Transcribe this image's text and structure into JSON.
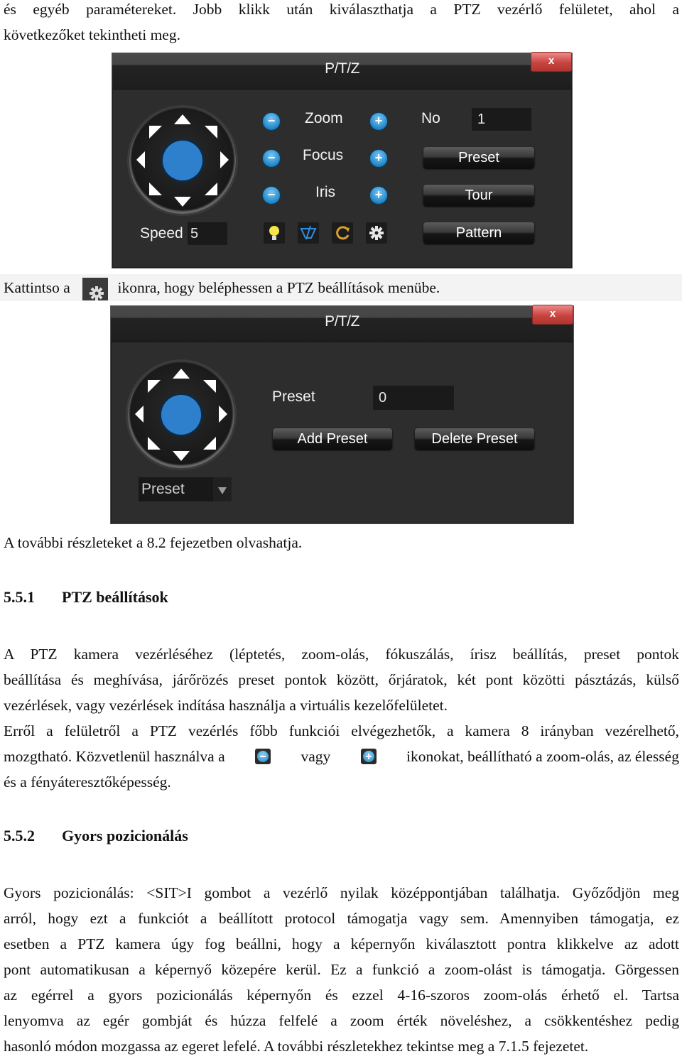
{
  "intro": {
    "lines": [
      "és egyéb paramétereket. Jobb klikk után kiválaszthatja a PTZ vezérlő felületet, ahol a",
      "következőket tekintheti meg."
    ]
  },
  "ptz_panel": {
    "title": "P/T/Z",
    "close_label": "x",
    "speed_label": "Speed",
    "speed_value": "5",
    "rows": [
      {
        "label": "Zoom",
        "minus": "−",
        "plus": "+"
      },
      {
        "label": "Focus",
        "minus": "−",
        "plus": "+"
      },
      {
        "label": "Iris",
        "minus": "−",
        "plus": "+"
      }
    ],
    "no_label": "No",
    "no_value": "1",
    "buttons": [
      "Preset",
      "Tour",
      "Pattern"
    ],
    "tools": [
      "light-bulb-icon",
      "wiper-icon",
      "auto-rotate-icon",
      "settings-gear-icon"
    ]
  },
  "instruction": {
    "before_icon": "Kattintso a",
    "after_icon": "ikonra, hogy beléphessen a PTZ beállítások menübe."
  },
  "ptz_settings_panel": {
    "title": "P/T/Z",
    "close_label": "x",
    "preset_label": "Preset",
    "preset_value": "0",
    "add_preset": "Add Preset",
    "delete_preset": "Delete Preset",
    "mode_select": "Preset"
  },
  "more_details": "A további részleteket a 8.2 fejezetben olvashatja.",
  "section_551": {
    "number": "5.5.1",
    "title": "PTZ beállítások",
    "para1_lines": [
      "A PTZ kamera vezérléséhez (léptetés, zoom-olás, fókuszálás, írisz beállítás, preset pontok",
      "beállítása és meghívása, járőrözés preset pontok között, őrjáratok, két pont közötti pásztázás, külső",
      "vezérlések, vagy vezérlések indítása használja a virtuális kezelőfelületet."
    ],
    "para2_line1": "Erről a felületről a PTZ vezérlés főbb funkciói elvégezhetők, a kamera 8 irányban vezérelhető,",
    "para2_line2_a": "mozgtható. Közvetlenül használva a",
    "para2_line2_b": "vagy",
    "para2_line2_c": "ikonokat, beállítható a zoom-olás, az élesség",
    "para2_line3": "és a fényáteresztőképesség."
  },
  "section_552": {
    "number": "5.5.2",
    "title": "Gyors pozicionálás",
    "lines": [
      "Gyors pozicionálás: <SIT>I gombot a vezérlő nyilak középpontjában találhatja. Győződjön meg",
      "arról, hogy ezt a funkciót a beállított protocol támogatja vagy sem. Amennyiben támogatja, ez",
      "esetben a PTZ kamera úgy fog beállni, hogy a képernyőn kiválasztott pontra klikkelve az adott",
      "pont automatikusan a képernyő közepére kerül. Ez a funkció a zoom-olást is támogatja. Görgessen",
      "az egérrel a gyors pozicionálás képernyőn és ezzel 4-16-szoros zoom-olás érhető el.  Tartsa",
      "lenyomva az egér gombját és húzza felfelé a zoom érték növeléshez, a csökkentéshez pedig",
      "hasonló módon mozgassa az egeret lefelé. A további részletekhez tekintse meg a 7.1.5 fejezetet."
    ]
  },
  "colors": {
    "panel_bg": "#2d2d2d",
    "accent_blue": "#2f80cc",
    "close_red": "#c9443f"
  }
}
